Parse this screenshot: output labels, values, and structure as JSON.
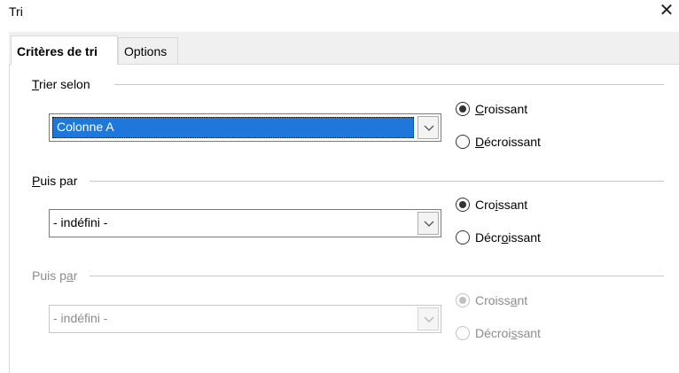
{
  "window": {
    "title": "Tri",
    "close_glyph": "✕"
  },
  "tabs": [
    {
      "label": "Critères de tri",
      "active": true
    },
    {
      "label": "Options",
      "active": false
    }
  ],
  "sections": [
    {
      "label_before": "",
      "label_mnemonic": "T",
      "label_after": "rier selon",
      "combo_value": "Colonne A",
      "combo_selected": true,
      "enabled": true,
      "radios": [
        {
          "before": "",
          "mnemonic": "C",
          "after": "roissant",
          "checked": true
        },
        {
          "before": "",
          "mnemonic": "D",
          "after": "écroissant",
          "checked": false
        }
      ]
    },
    {
      "label_before": "",
      "label_mnemonic": "P",
      "label_after": "uis par",
      "combo_value": "- indéfini -",
      "combo_selected": false,
      "enabled": true,
      "radios": [
        {
          "before": "Cro",
          "mnemonic": "i",
          "after": "ssant",
          "checked": true
        },
        {
          "before": "Décr",
          "mnemonic": "o",
          "after": "issant",
          "checked": false
        }
      ]
    },
    {
      "label_before": "Puis p",
      "label_mnemonic": "a",
      "label_after": "r",
      "combo_value": "- indéfini -",
      "combo_selected": false,
      "enabled": false,
      "radios": [
        {
          "before": "Croiss",
          "mnemonic": "a",
          "after": "nt",
          "checked": true
        },
        {
          "before": "Décroi",
          "mnemonic": "s",
          "after": "sant",
          "checked": false
        }
      ]
    }
  ],
  "colors": {
    "selection": "#1e78dc",
    "disabled_text": "#8c8c8c"
  }
}
